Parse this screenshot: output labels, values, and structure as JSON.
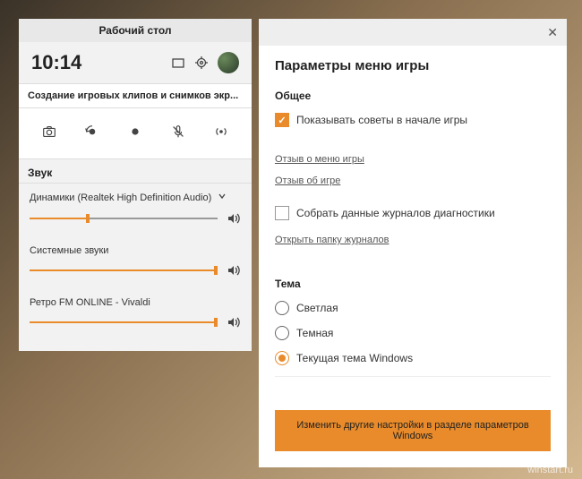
{
  "left": {
    "header": "Рабочий стол",
    "time": "10:14",
    "subtitle": "Создание игровых клипов и снимков экр...",
    "sound_section": "Звук",
    "audio": [
      {
        "label": "Динамики (Realtek High Definition Audio)",
        "expandable": true,
        "level": 30
      },
      {
        "label": "Системные звуки",
        "expandable": false,
        "level": 100
      },
      {
        "label": "Ретро FM ONLINE - Vivaldi",
        "expandable": false,
        "level": 100
      }
    ]
  },
  "right": {
    "title": "Параметры меню игры",
    "general": {
      "heading": "Общее",
      "show_tips": "Показывать советы в начале игры",
      "feedback_menu": "Отзыв о меню игры",
      "feedback_game": "Отзыв об игре",
      "collect_logs": "Собрать данные журналов диагностики",
      "open_logs": "Открыть папку журналов"
    },
    "theme": {
      "heading": "Тема",
      "light": "Светлая",
      "dark": "Темная",
      "current": "Текущая тема Windows"
    },
    "footer_btn": "Изменить другие настройки в разделе параметров Windows"
  },
  "watermark": "winstart.ru"
}
